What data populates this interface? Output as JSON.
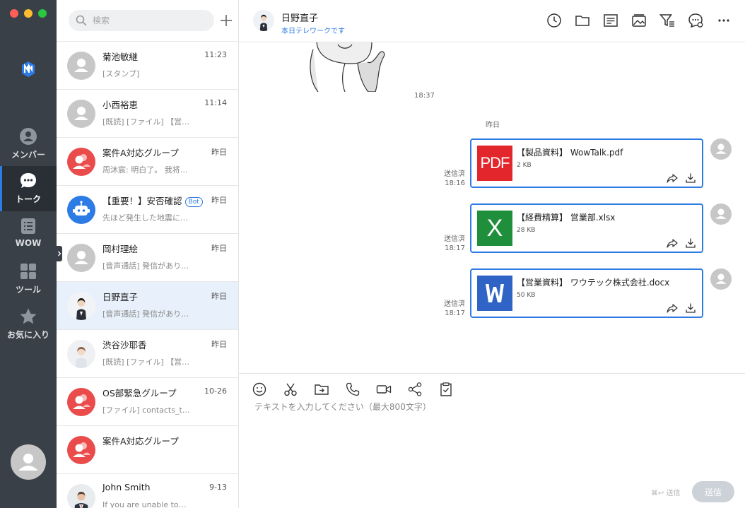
{
  "nav": {
    "items": [
      {
        "label": "メンバー"
      },
      {
        "label": "トーク"
      },
      {
        "label": "WOW"
      },
      {
        "label": "ツール"
      },
      {
        "label": "お気に入り"
      }
    ]
  },
  "search": {
    "placeholder": "検索"
  },
  "conversations": [
    {
      "name": "菊池敏継",
      "time": "11:23",
      "preview": "[スタンプ]"
    },
    {
      "name": "小西裕恵",
      "time": "11:14",
      "preview": "[既読] [ファイル] 【営…"
    },
    {
      "name": "案件A対応グループ",
      "time": "昨日",
      "preview": "周沐宸: 明白了。 我将…"
    },
    {
      "name": "【重要！】安否確認",
      "badge": "Bot",
      "time": "昨日",
      "preview": "先ほど発生した地震に…"
    },
    {
      "name": "岡村理絵",
      "time": "昨日",
      "preview": "[音声通話] 発信があり…"
    },
    {
      "name": "日野直子",
      "time": "昨日",
      "preview": "[音声通話] 発信があり…"
    },
    {
      "name": "渋谷沙耶香",
      "time": "昨日",
      "preview": "[既読] [ファイル] 【営…"
    },
    {
      "name": "OS部緊急グループ",
      "time": "10-26",
      "preview": "[ファイル] contacts_t…"
    },
    {
      "name": "案件A対応グループ",
      "time": "",
      "preview": ""
    },
    {
      "name": "John Smith",
      "time": "9-13",
      "preview": "If you are unable to…"
    }
  ],
  "chat": {
    "peer_name": "日野直子",
    "peer_status": "本日テレワークです",
    "sticker_time": "18:37",
    "date_divider": "昨日",
    "files": [
      {
        "name": "【製品資料】 WowTalk.pdf",
        "size": "2 KB",
        "type_label": "PDF",
        "status": "送信済",
        "time": "18:16"
      },
      {
        "name": "【経費精算】 営業部.xlsx",
        "size": "28 KB",
        "type_label": "X",
        "status": "送信済",
        "time": "18:17"
      },
      {
        "name": "【営業資料】 ワウテック株式会社.docx",
        "size": "50 KB",
        "type_label": "W",
        "status": "送信済",
        "time": "18:17"
      }
    ]
  },
  "composer": {
    "placeholder": "テキストを入力してください（最大800文字）",
    "send_hint": "⌘↩ 送信",
    "send_label": "送信"
  }
}
